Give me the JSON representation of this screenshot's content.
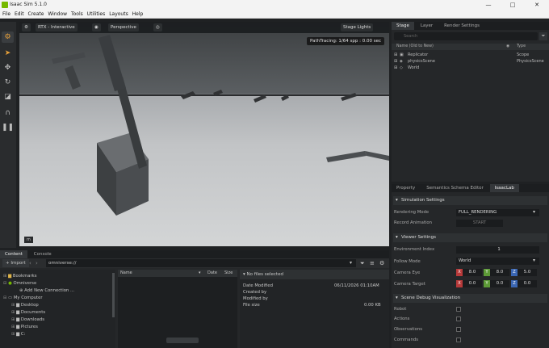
{
  "window": {
    "title": "Isaac Sim 5.1.0",
    "min": "—",
    "restore": "□",
    "close": "✕"
  },
  "menu": [
    "File",
    "Edit",
    "Create",
    "Window",
    "Tools",
    "Utilities",
    "Layouts",
    "Help"
  ],
  "viewport": {
    "rtx_label": "RTX - Interactive",
    "camera_label": "Perspective",
    "stage_lights": "Stage Lights",
    "path_tracing": "PathTracing: 1/64 spp : 0.00 sec",
    "units": "m"
  },
  "stage_panel": {
    "tabs": [
      "Stage",
      "Layer",
      "Render Settings"
    ],
    "search_placeholder": "Search",
    "col_name": "Name (Old to New)",
    "col_type": "Type",
    "rows": [
      {
        "name": "Replicator",
        "type": "Scope"
      },
      {
        "name": "physicsScene",
        "type": "PhysicsScene"
      },
      {
        "name": "World",
        "type": ""
      }
    ]
  },
  "property_panel": {
    "tabs": [
      "Property",
      "Semantics Schema Editor",
      "IsaacLab"
    ],
    "sim_settings": "Simulation Settings",
    "rendering_mode_label": "Rendering Mode",
    "rendering_mode_value": "FULL_RENDERING",
    "record_anim_label": "Record Animation",
    "record_anim_button": "START",
    "viewer_settings": "Viewer Settings",
    "env_index_label": "Environment Index",
    "env_index_value": "1",
    "follow_mode_label": "Follow Mode",
    "follow_mode_value": "World",
    "cam_eye_label": "Camera Eye",
    "cam_eye": [
      "8.0",
      "8.0",
      "5.0"
    ],
    "cam_target_label": "Camera Target",
    "cam_target": [
      "0.0",
      "0.0",
      "0.0"
    ],
    "axes": [
      "X",
      "Y",
      "Z"
    ],
    "debug_vis": "Scene Debug Visualization",
    "debug_items": [
      "Robot",
      "Actions",
      "Observations",
      "Commands"
    ]
  },
  "content": {
    "tabs": [
      "Content",
      "Console"
    ],
    "import_label": "+ Import",
    "path": "omniverse://",
    "tree": [
      "Bookmarks",
      "Omniverse",
      "Add New Connection ...",
      "My Computer",
      "Desktop",
      "Documents",
      "Downloads",
      "Pictures",
      "C:"
    ],
    "col_name": "Name",
    "col_date": "Date",
    "col_size": "Size",
    "no_files": "No files selected",
    "date_modified_label": "Date Modified",
    "date_modified_value": "06/11/2026 01:10AM",
    "created_by_label": "Created by",
    "modified_by_label": "Modified by",
    "file_size_label": "File size",
    "file_size_value": "0.00 KB"
  }
}
